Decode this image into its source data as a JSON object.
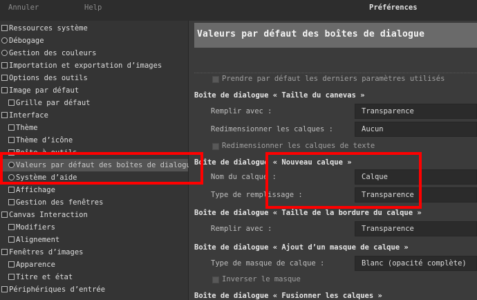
{
  "topbar": {
    "cancel": "Annuler",
    "help": "Help",
    "title": "Préférences"
  },
  "nav": [
    {
      "label": "Ressources système",
      "icon": "cpu-icon"
    },
    {
      "label": "Débogage",
      "icon": "bug-icon"
    },
    {
      "label": "Gestion des couleurs",
      "icon": "palette-icon"
    },
    {
      "label": "Importation et exportation d’images",
      "icon": "import-export-icon"
    },
    {
      "label": "Options des outils",
      "icon": "tools-icon"
    },
    {
      "label": "Image par défaut",
      "icon": "image-icon"
    },
    {
      "label": "Grille par défaut",
      "icon": "grid-icon"
    },
    {
      "label": "Interface",
      "icon": "interface-icon"
    },
    {
      "label": "Thème",
      "icon": "theme-icon"
    },
    {
      "label": "Thème d’icône",
      "icon": "icon-theme-icon"
    },
    {
      "label": "Boîte à outils",
      "icon": "toolbox-icon"
    },
    {
      "label": "Valeurs par défaut des boîtes de dialogue",
      "icon": "dialog-defaults-icon"
    },
    {
      "label": "Système d’aide",
      "icon": "help-system-icon"
    },
    {
      "label": "Affichage",
      "icon": "display-icon"
    },
    {
      "label": "Gestion des fenêtres",
      "icon": "window-management-icon"
    },
    {
      "label": "Canvas Interaction",
      "icon": "canvas-icon"
    },
    {
      "label": "Modifiers",
      "icon": "modifiers-icon"
    },
    {
      "label": "Alignement",
      "icon": "alignment-icon"
    },
    {
      "label": "Fenêtres d’images",
      "icon": "image-windows-icon"
    },
    {
      "label": "Apparence",
      "icon": "appearance-icon"
    },
    {
      "label": "Titre et état",
      "icon": "title-status-icon"
    },
    {
      "label": "Périphériques d’entrée",
      "icon": "input-devices-icon"
    }
  ],
  "main": {
    "title": "Valeurs par défaut des boîtes de dialogue",
    "use_last": "Prendre par défaut les derniers paramètres utilisés",
    "sections": {
      "canvas_size": {
        "title": "Boîte de dialogue « Taille du canevas »",
        "fill_label": "Remplir avec :",
        "fill_value": "Transparence",
        "resize_label": "Redimensionner les calques :",
        "resize_value": "Aucun",
        "resize_text_label": "Redimensionner les calques de texte"
      },
      "new_layer": {
        "title": "Boîte de dialogue « Nouveau calque »",
        "name_label": "Nom du calque :",
        "name_value": "Calque",
        "fill_type_label": "Type de remplissage :",
        "fill_type_value": "Transparence"
      },
      "layer_boundary": {
        "title": "Boîte de dialogue « Taille de la bordure du calque »",
        "fill_label": "Remplir avec :",
        "fill_value": "Transparence"
      },
      "layer_mask": {
        "title": "Boîte de dialogue « Ajout d’un masque de calque »",
        "mask_type_label": "Type de masque de calque :",
        "mask_type_value": "Blanc (opacité complète)",
        "invert_label": "Inverser le masque"
      },
      "merge_layers": {
        "title": "Boîte de dialogue « Fusionner les calques »"
      }
    }
  },
  "colors": {
    "highlight": "#ff0000",
    "selected_row": "#545454"
  }
}
